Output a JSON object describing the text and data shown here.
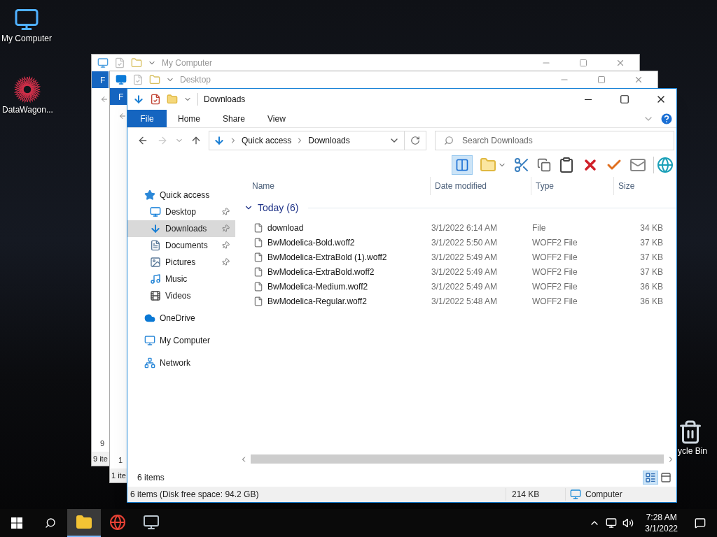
{
  "desktop_icons": [
    {
      "kind": "computer",
      "label": "My Computer"
    },
    {
      "kind": "app",
      "label": "DataWagon..."
    },
    {
      "kind": "recycle",
      "label": "ycle Bin"
    }
  ],
  "back_windows": [
    {
      "kind": "computer",
      "title": "My Computer",
      "file_tab": "F",
      "item_count": "9",
      "status": "9 ite"
    },
    {
      "kind": "desktop",
      "title": "Desktop",
      "file_tab": "F",
      "item_count": "1",
      "status": "1 ite"
    }
  ],
  "window": {
    "title": "Downloads",
    "ribbon_tabs": [
      {
        "label": "File",
        "selected": true
      },
      {
        "label": "Home",
        "selected": false
      },
      {
        "label": "Share",
        "selected": false
      },
      {
        "label": "View",
        "selected": false
      }
    ],
    "address": [
      "Quick access",
      "Downloads"
    ],
    "search": {
      "placeholder": "Search Downloads"
    },
    "nav": [
      {
        "kind": "star",
        "label": "Quick access",
        "selected": false,
        "children": [
          {
            "kind": "desktop",
            "label": "Desktop",
            "pinned": true,
            "selected": false
          },
          {
            "kind": "download",
            "label": "Downloads",
            "pinned": true,
            "selected": true
          },
          {
            "kind": "documents",
            "label": "Documents",
            "pinned": true,
            "selected": false
          },
          {
            "kind": "pictures",
            "label": "Pictures",
            "pinned": true,
            "selected": false
          },
          {
            "kind": "music",
            "label": "Music",
            "pinned": false,
            "selected": false
          },
          {
            "kind": "videos",
            "label": "Videos",
            "pinned": false,
            "selected": false
          }
        ]
      },
      {
        "kind": "cloud",
        "label": "OneDrive",
        "selected": false
      },
      {
        "kind": "computer",
        "label": "My Computer",
        "selected": false
      },
      {
        "kind": "network",
        "label": "Network",
        "selected": false
      }
    ],
    "columns": [
      "Name",
      "Date modified",
      "Type",
      "Size"
    ],
    "group": {
      "label": "Today (6)",
      "expanded": true
    },
    "rows": [
      {
        "name": "download",
        "date": "3/1/2022 6:14 AM",
        "type": "File",
        "size": "34 KB"
      },
      {
        "name": "BwModelica-Bold.woff2",
        "date": "3/1/2022 5:50 AM",
        "type": "WOFF2 File",
        "size": "37 KB"
      },
      {
        "name": "BwModelica-ExtraBold (1).woff2",
        "date": "3/1/2022 5:49 AM",
        "type": "WOFF2 File",
        "size": "37 KB"
      },
      {
        "name": "BwModelica-ExtraBold.woff2",
        "date": "3/1/2022 5:49 AM",
        "type": "WOFF2 File",
        "size": "37 KB"
      },
      {
        "name": "BwModelica-Medium.woff2",
        "date": "3/1/2022 5:49 AM",
        "type": "WOFF2 File",
        "size": "36 KB"
      },
      {
        "name": "BwModelica-Regular.woff2",
        "date": "3/1/2022 5:48 AM",
        "type": "WOFF2 File",
        "size": "36 KB"
      }
    ],
    "item_count": "6 items",
    "view_buttons": [
      {
        "kind": "details",
        "selected": true
      },
      {
        "kind": "tiles",
        "selected": false
      }
    ],
    "status_bar": {
      "summary": "6 items (Disk free space: 94.2 GB)",
      "size": "214 KB",
      "location": "Computer"
    }
  },
  "taskbar": {
    "apps": [
      {
        "kind": "explorer",
        "active": true
      },
      {
        "kind": "chrome",
        "active": false
      },
      {
        "kind": "monitor",
        "active": false
      }
    ],
    "time": "7:28 AM",
    "date": "3/1/2022"
  }
}
